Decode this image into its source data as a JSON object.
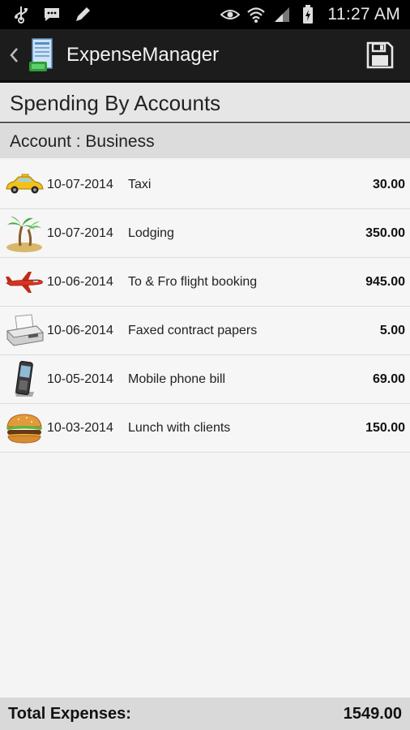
{
  "status_bar": {
    "time": "11:27 AM",
    "icons": [
      "usb-icon",
      "message-icon",
      "edit-icon",
      "eye-icon",
      "wifi-icon",
      "signal-icon",
      "battery-icon"
    ]
  },
  "action_bar": {
    "title": "ExpenseManager",
    "icons": [
      "back-chevron-icon",
      "app-logo-icon",
      "save-disk-icon"
    ]
  },
  "page": {
    "title": "Spending By Accounts",
    "account_label": "Account : Business"
  },
  "expenses": [
    {
      "icon": "taxi-icon",
      "date": "10-07-2014",
      "description": "Taxi",
      "amount": "30.00"
    },
    {
      "icon": "island-palm-icon",
      "date": "10-07-2014",
      "description": "Lodging",
      "amount": "350.00"
    },
    {
      "icon": "airplane-icon",
      "date": "10-06-2014",
      "description": "To & Fro flight booking",
      "amount": "945.00"
    },
    {
      "icon": "fax-printer-icon",
      "date": "10-06-2014",
      "description": "Faxed contract  papers",
      "amount": "5.00"
    },
    {
      "icon": "mobile-phone-icon",
      "date": "10-05-2014",
      "description": "Mobile phone bill",
      "amount": "69.00"
    },
    {
      "icon": "burger-icon",
      "date": "10-03-2014",
      "description": "Lunch with clients",
      "amount": "150.00"
    }
  ],
  "footer": {
    "label": "Total Expenses:",
    "total": "1549.00"
  }
}
